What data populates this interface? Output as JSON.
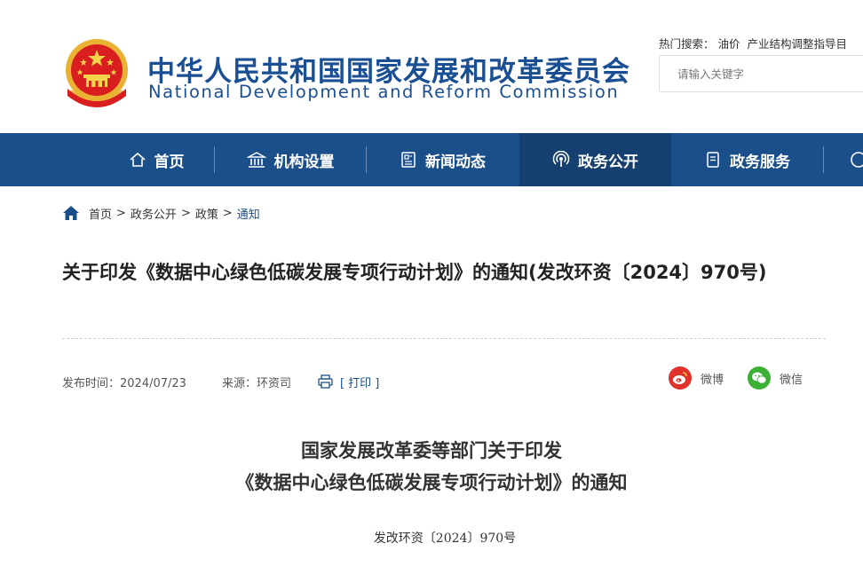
{
  "header": {
    "site_name_cn": "中华人民共和国国家发展和改革委员会",
    "site_name_en": "National Development and Reform Commission",
    "hot_search": {
      "label": "热门搜索：",
      "items": [
        "油价",
        "产业结构调整指导目"
      ]
    },
    "search": {
      "placeholder": "请输入关键字"
    }
  },
  "nav": {
    "items": [
      {
        "label": "首页",
        "icon": "home-icon"
      },
      {
        "label": "机构设置",
        "icon": "building-icon"
      },
      {
        "label": "新闻动态",
        "icon": "newspaper-icon"
      },
      {
        "label": "政务公开",
        "icon": "broadcast-icon",
        "active": true
      },
      {
        "label": "政务服务",
        "icon": "document-icon"
      }
    ]
  },
  "breadcrumb": {
    "items": [
      "首页",
      "政务公开",
      "政策",
      "通知"
    ],
    "separator": ">"
  },
  "article": {
    "title": "关于印发《数据中心绿色低碳发展专项行动计划》的通知(发改环资〔2024〕970号)",
    "publish_time": "发布时间：2024/07/23",
    "source": "来源：环资司",
    "print_label": "[ 打印 ]",
    "share": {
      "weibo": "微博",
      "wechat": "微信"
    },
    "heading_line1": "国家发展改革委等部门关于印发",
    "heading_line2": "《数据中心绿色低碳发展专项行动计划》的通知",
    "doc_number": "发改环资〔2024〕970号"
  },
  "colors": {
    "brand_blue": "#1b4f93",
    "nav_bg": "#1b4f8a",
    "nav_active_bg": "#16406f",
    "weibo_red": "#e0312b",
    "wechat_green": "#3cb034"
  }
}
